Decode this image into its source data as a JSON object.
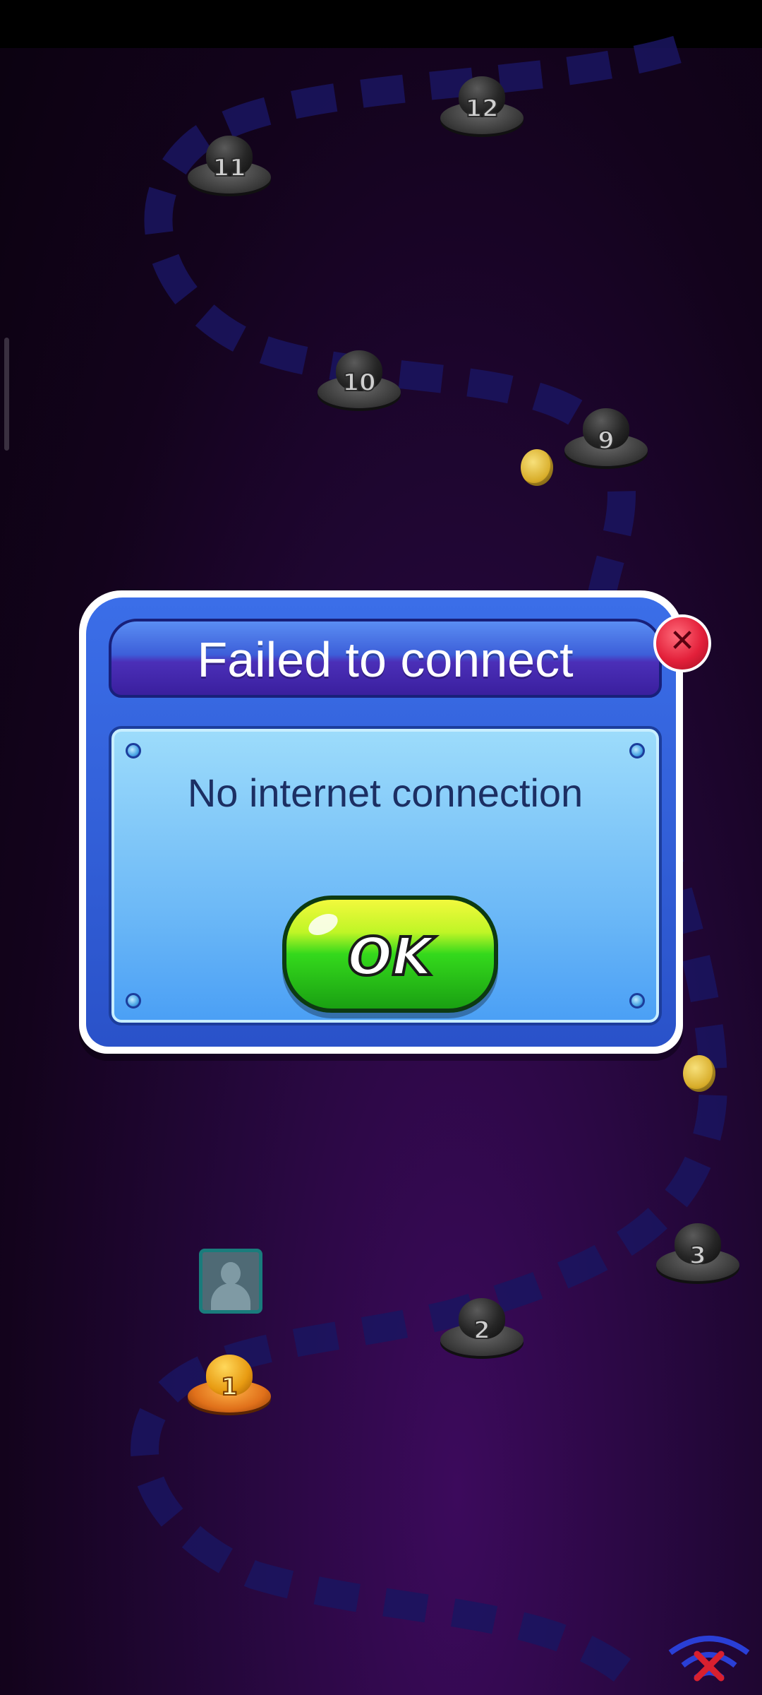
{
  "dialog": {
    "title": "Failed to connect",
    "message": "No internet connection",
    "ok_label": "OK",
    "close_symbol": "✕"
  },
  "level_map": {
    "levels": [
      {
        "number": "1",
        "state": "current"
      },
      {
        "number": "2",
        "state": "locked"
      },
      {
        "number": "3",
        "state": "locked"
      },
      {
        "number": "9",
        "state": "locked"
      },
      {
        "number": "10",
        "state": "locked"
      },
      {
        "number": "11",
        "state": "locked"
      },
      {
        "number": "12",
        "state": "locked"
      }
    ]
  },
  "icons": {
    "avatar": "player-avatar-icon",
    "wifi_status": "wifi-off-icon",
    "coin": "coin-icon"
  },
  "colors": {
    "dialog_blue": "#2a52c9",
    "ok_green": "#34d91c",
    "close_red": "#e3203a"
  }
}
